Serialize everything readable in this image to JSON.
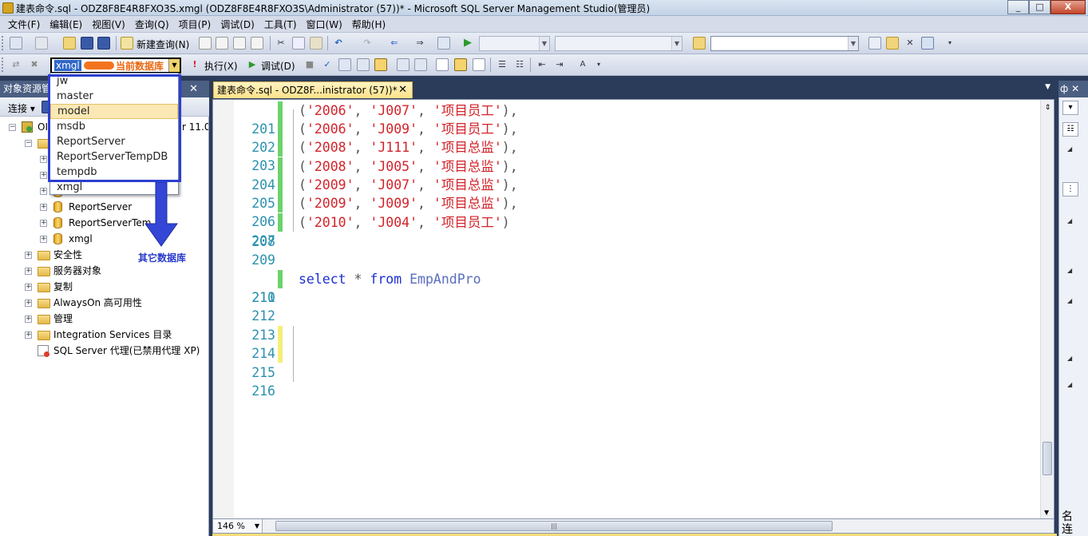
{
  "window": {
    "title": "建表命令.sql - ODZ8F8E4R8FXO3S.xmgl (ODZ8F8E4R8FXO3S\\Administrator (57))* - Microsoft SQL Server Management Studio(管理员)",
    "buttons": [
      "_",
      "□",
      "X"
    ]
  },
  "menu": [
    "文件(F)",
    "编辑(E)",
    "视图(V)",
    "查询(Q)",
    "项目(P)",
    "调试(D)",
    "工具(T)",
    "窗口(W)",
    "帮助(H)"
  ],
  "toolbar1": {
    "new_query": "新建查询(N)"
  },
  "toolbar2": {
    "current_db": "xmgl",
    "execute": "执行(X)",
    "debug": "调试(D)"
  },
  "annotations": {
    "current_db": "当前数据库",
    "other_dbs": "其它数据库"
  },
  "db_dropdown": {
    "options": [
      "jw",
      "master",
      "model",
      "msdb",
      "ReportServer",
      "ReportServerTempDB",
      "tempdb",
      "xmgl"
    ],
    "highlighted": "model"
  },
  "object_explorer": {
    "title": "对象资源管",
    "connect": "连接",
    "server_label": "OI",
    "server_version_fragment": "r 11.0",
    "databases": [
      "ReportServer",
      "ReportServerTem",
      "xmgl"
    ],
    "folders": [
      "安全性",
      "服务器对象",
      "复制",
      "AlwaysOn 高可用性",
      "管理",
      "Integration Services 目录"
    ],
    "agent": "SQL Server 代理(已禁用代理 XP)"
  },
  "editor": {
    "tab_label": "建表命令.sql - ODZ8F...inistrator (57))*",
    "lines": [
      {
        "n": "201",
        "mark": "g",
        "year": "'2006'",
        "job": "'J007'",
        "role": "'项目员工'",
        "end": "),"
      },
      {
        "n": "202",
        "mark": "g",
        "year": "'2006'",
        "job": "'J009'",
        "role": "'项目员工'",
        "end": "),"
      },
      {
        "n": "203",
        "mark": "g",
        "year": "'2008'",
        "job": "'J111'",
        "role": "'项目总监'",
        "end": "),"
      },
      {
        "n": "204",
        "mark": "g",
        "year": "'2008'",
        "job": "'J005'",
        "role": "'项目总监'",
        "end": "),"
      },
      {
        "n": "205",
        "mark": "g",
        "year": "'2009'",
        "job": "'J007'",
        "role": "'项目总监'",
        "end": "),"
      },
      {
        "n": "206",
        "mark": "g",
        "year": "'2009'",
        "job": "'J009'",
        "role": "'项目总监'",
        "end": "),"
      },
      {
        "n": "207",
        "mark": "g",
        "year": "'2010'",
        "job": "'J004'",
        "role": "'项目员工'",
        "end": ")"
      }
    ],
    "empty_lines": [
      "208",
      "209"
    ],
    "query_line": {
      "n": "210",
      "select": "select",
      "star": "*",
      "from": "from",
      "table": "EmpAndPro"
    },
    "trailing_lines": [
      "211",
      "212",
      "213",
      "214",
      "215",
      "216"
    ],
    "zoom": "146 %"
  },
  "right_panel": {
    "title": "中",
    "bottom_text": "名\n连"
  },
  "colors": {
    "string": "#d2232a",
    "keyword": "#1d2fd1",
    "line_number": "#2b91af",
    "changed_saved": "#6cd26c",
    "changed_unsaved": "#f4ee7a"
  }
}
